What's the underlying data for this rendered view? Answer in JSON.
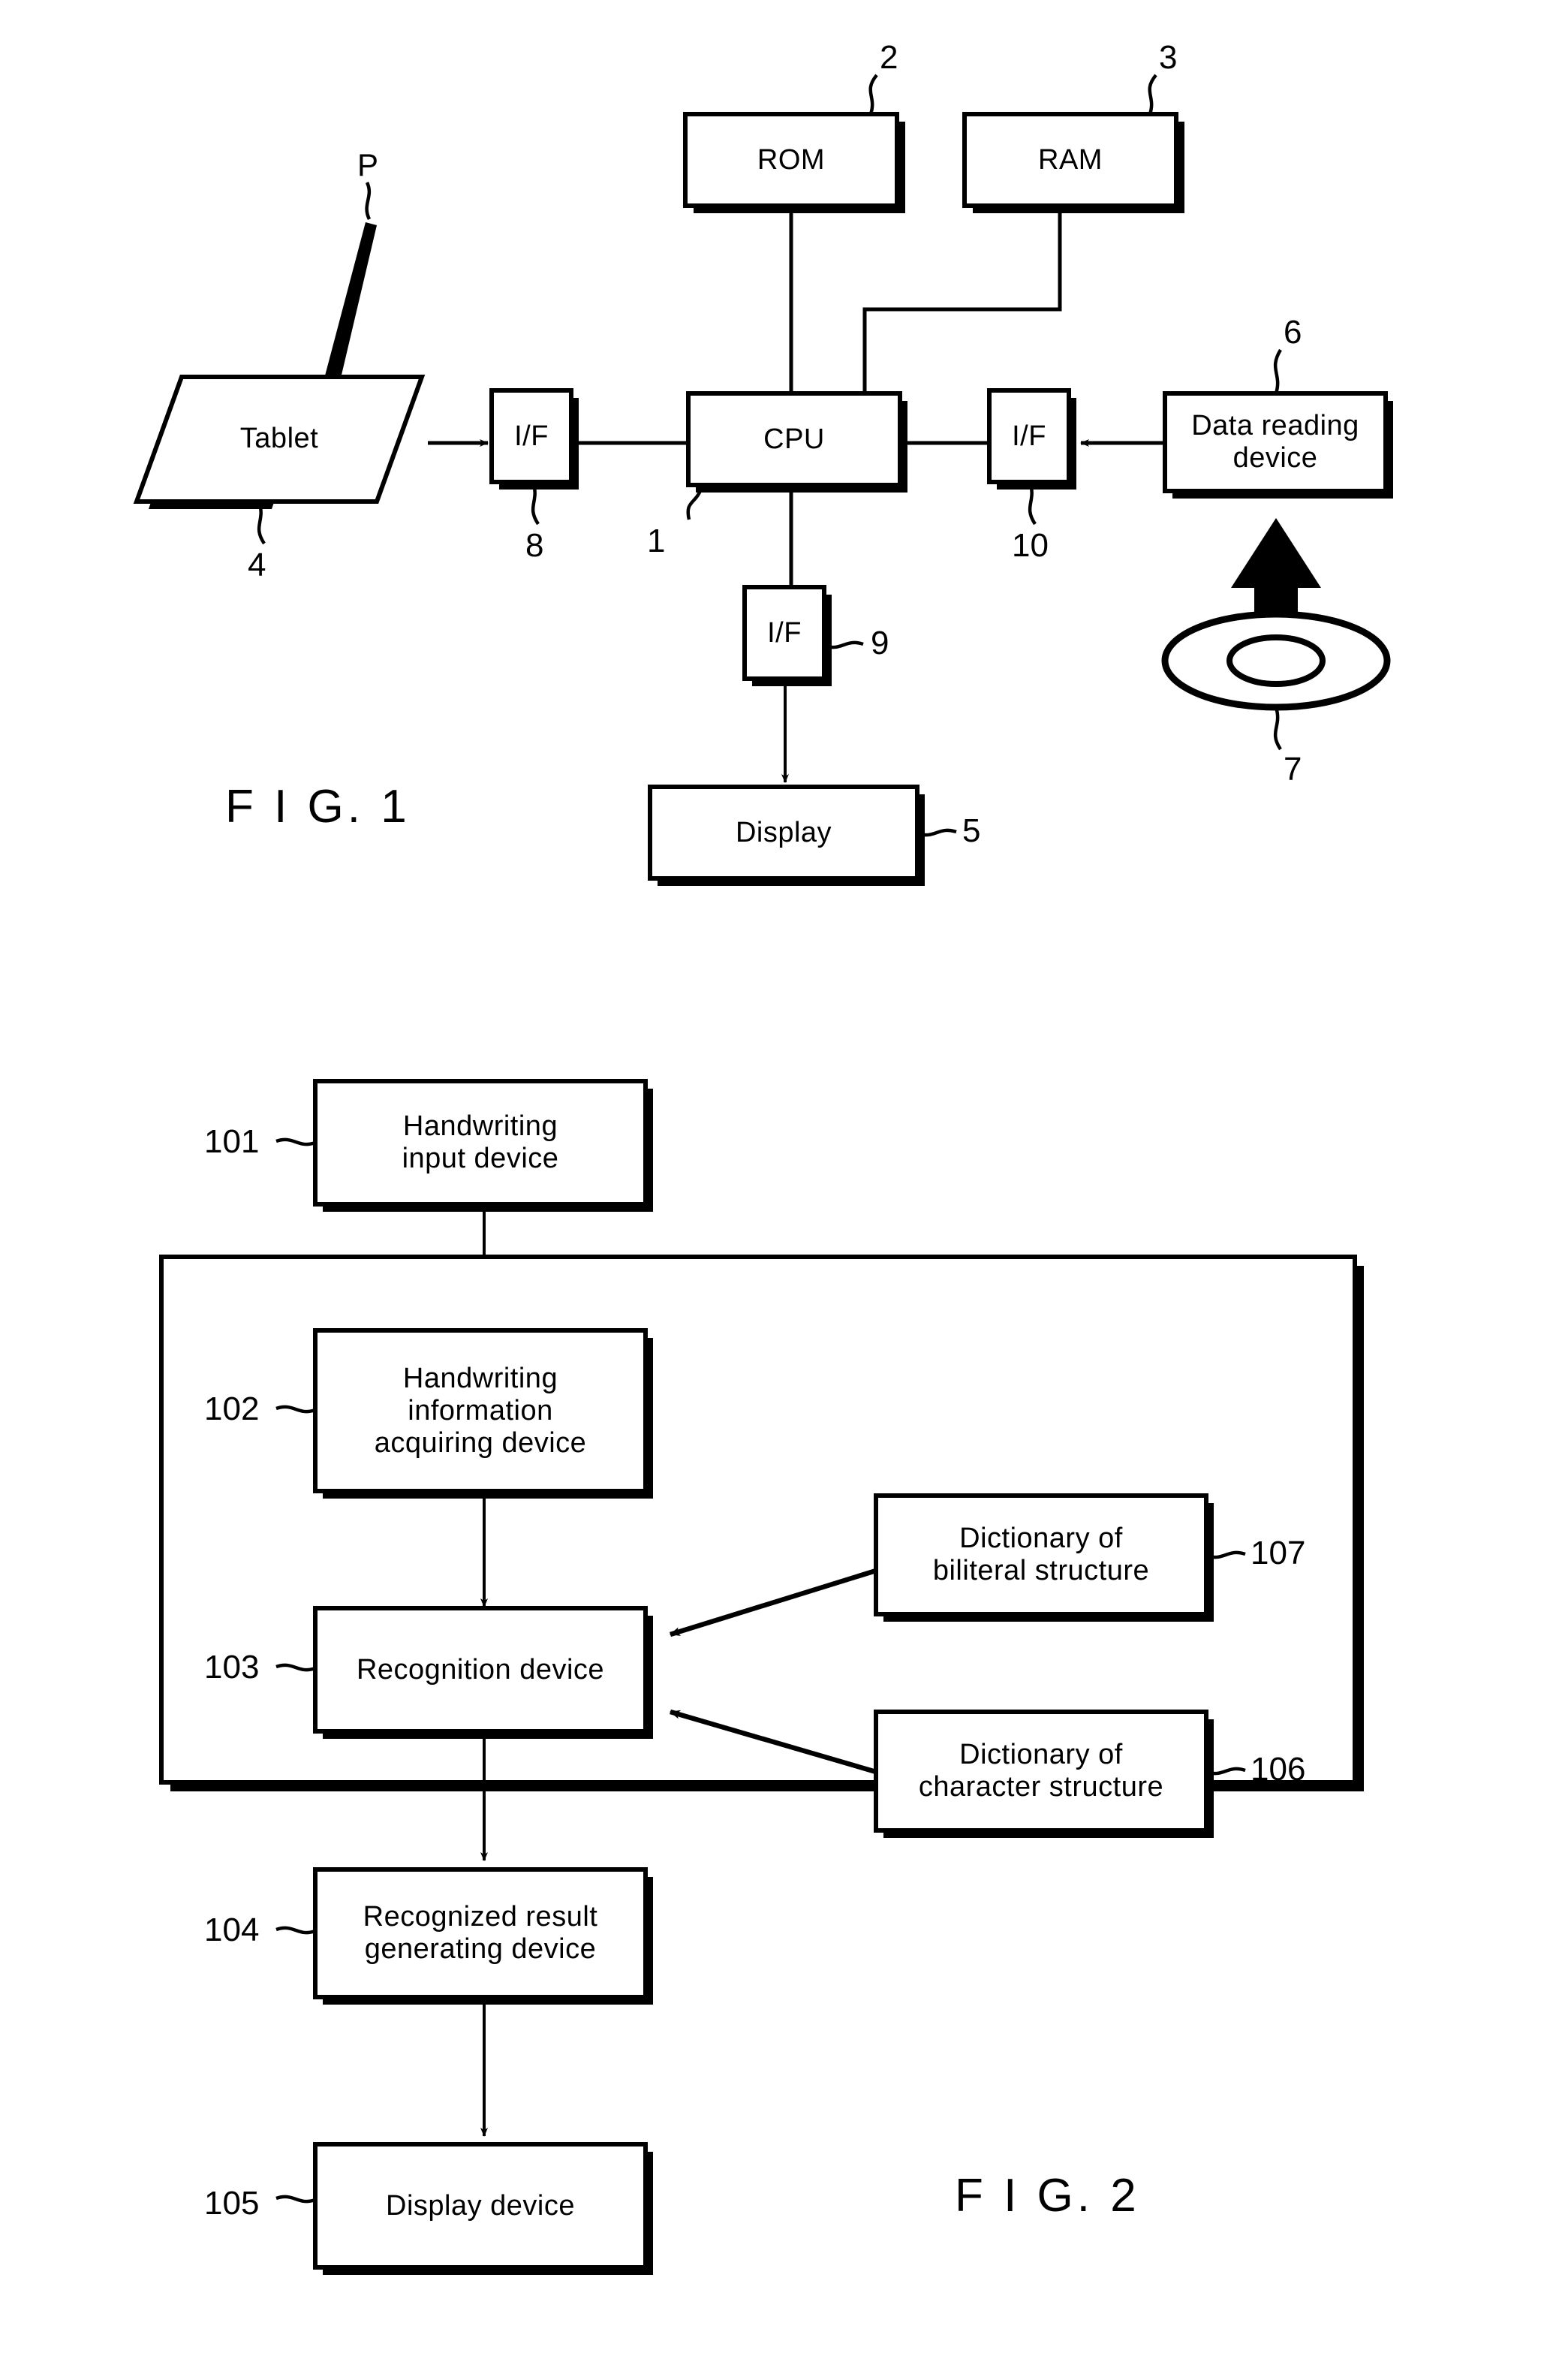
{
  "document": {
    "type": "patent-figure-sheet",
    "figures": [
      "FIG. 1",
      "FIG. 2"
    ]
  },
  "fig1": {
    "caption": "F I G. 1",
    "blocks": {
      "rom": {
        "label": "ROM",
        "ref": "2"
      },
      "ram": {
        "label": "RAM",
        "ref": "3"
      },
      "tablet": {
        "label": "Tablet",
        "ref": "4"
      },
      "pen": {
        "ref": "P"
      },
      "if_tablet": {
        "label": "I/F",
        "ref": "8"
      },
      "cpu": {
        "label": "CPU",
        "ref": "1"
      },
      "if_reader": {
        "label": "I/F",
        "ref": "10"
      },
      "data_reader": {
        "label_line1": "Data  reading",
        "label_line2": "device",
        "ref": "6"
      },
      "disc": {
        "ref": "7"
      },
      "if_display": {
        "label": "I/F",
        "ref": "9"
      },
      "display": {
        "label": "Display",
        "ref": "5"
      }
    },
    "connections": [
      {
        "from": "tablet",
        "to": "if_tablet",
        "arrow": true
      },
      {
        "from": "if_tablet",
        "to": "cpu",
        "arrow": false
      },
      {
        "from": "rom",
        "to": "cpu",
        "arrow": false
      },
      {
        "from": "ram",
        "to": "cpu",
        "arrow": false
      },
      {
        "from": "cpu",
        "to": "if_reader",
        "arrow": false
      },
      {
        "from": "data_reader",
        "to": "if_reader",
        "arrow": true
      },
      {
        "from": "disc",
        "to": "data_reader",
        "arrow": true
      },
      {
        "from": "cpu",
        "to": "if_display",
        "arrow": false
      },
      {
        "from": "if_display",
        "to": "display",
        "arrow": true
      }
    ]
  },
  "fig2": {
    "caption": "F I G. 2",
    "blocks": {
      "handwriting_input": {
        "label_line1": "Handwriting",
        "label_line2": "input  device",
        "ref": "101"
      },
      "handwriting_info": {
        "label_line1": "Handwriting",
        "label_line2": "information",
        "label_line3": "acquiring  device",
        "ref": "102"
      },
      "recognition": {
        "label": "Recognition  device",
        "ref": "103"
      },
      "recognized_result": {
        "label_line1": "Recognized  result",
        "label_line2": "generating  device",
        "ref": "104"
      },
      "display_device": {
        "label": "Display  device",
        "ref": "105"
      },
      "dict_biliteral": {
        "label_line1": "Dictionary  of",
        "label_line2": "biliteral  structure",
        "ref": "107"
      },
      "dict_character": {
        "label_line1": "Dictionary  of",
        "label_line2": "character  structure",
        "ref": "106"
      }
    },
    "connections": [
      {
        "from": "handwriting_input",
        "to": "handwriting_info",
        "arrow": true
      },
      {
        "from": "handwriting_info",
        "to": "recognition",
        "arrow": true
      },
      {
        "from": "recognition",
        "to": "recognized_result",
        "arrow": true
      },
      {
        "from": "recognized_result",
        "to": "display_device",
        "arrow": true
      },
      {
        "from": "dict_biliteral",
        "to": "recognition",
        "arrow": true
      },
      {
        "from": "dict_character",
        "to": "recognition",
        "arrow": true
      }
    ]
  },
  "colors": {
    "ink": "#000000",
    "paper": "#ffffff"
  }
}
